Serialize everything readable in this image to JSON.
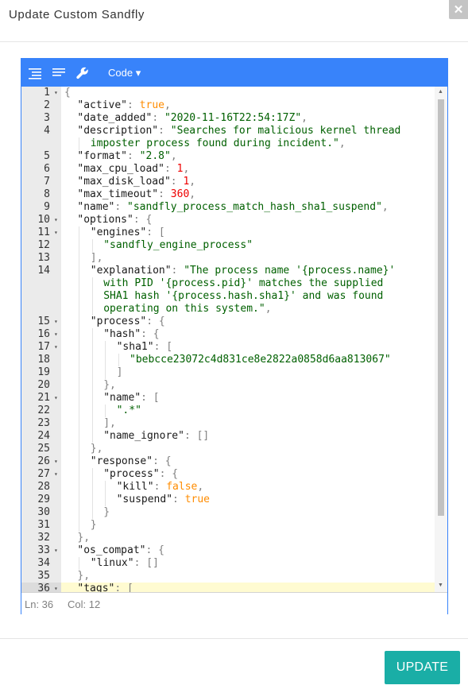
{
  "modal": {
    "title": "Update Custom Sandfly",
    "close_glyph": "✕"
  },
  "menubar": {
    "mode_label": "Code ▾",
    "icons": [
      "format-icon",
      "compact-icon",
      "repair-icon"
    ]
  },
  "status": {
    "line": "Ln: 36",
    "col": "Col: 12"
  },
  "footer": {
    "update_label": "UPDATE"
  },
  "colors": {
    "accent": "#3883fa",
    "button": "#1aaea6",
    "string": "#006000",
    "number": "#ee0000",
    "boolean": "#ff8c00"
  },
  "code_lines": [
    {
      "num": "1",
      "fold": true,
      "indent": 0,
      "tokens": [
        [
          "p",
          "{"
        ]
      ]
    },
    {
      "num": "2",
      "fold": false,
      "indent": 1,
      "tokens": [
        [
          "k",
          "\"active\""
        ],
        [
          "p",
          ": "
        ],
        [
          "b",
          "true"
        ],
        [
          "p",
          ","
        ]
      ]
    },
    {
      "num": "3",
      "fold": false,
      "indent": 1,
      "tokens": [
        [
          "k",
          "\"date_added\""
        ],
        [
          "p",
          ": "
        ],
        [
          "s",
          "\"2020-11-16T22:54:17Z\""
        ],
        [
          "p",
          ","
        ]
      ]
    },
    {
      "num": "4",
      "fold": false,
      "indent": 1,
      "tokens": [
        [
          "k",
          "\"description\""
        ],
        [
          "p",
          ": "
        ],
        [
          "s",
          "\"Searches for malicious kernel thread"
        ]
      ]
    },
    {
      "num": "",
      "fold": false,
      "indent": 2,
      "cont": true,
      "tokens": [
        [
          "s",
          "imposter process found during incident.\""
        ],
        [
          "p",
          ","
        ]
      ]
    },
    {
      "num": "5",
      "fold": false,
      "indent": 1,
      "tokens": [
        [
          "k",
          "\"format\""
        ],
        [
          "p",
          ": "
        ],
        [
          "s",
          "\"2.8\""
        ],
        [
          "p",
          ","
        ]
      ]
    },
    {
      "num": "6",
      "fold": false,
      "indent": 1,
      "tokens": [
        [
          "k",
          "\"max_cpu_load\""
        ],
        [
          "p",
          ": "
        ],
        [
          "n",
          "1"
        ],
        [
          "p",
          ","
        ]
      ]
    },
    {
      "num": "7",
      "fold": false,
      "indent": 1,
      "tokens": [
        [
          "k",
          "\"max_disk_load\""
        ],
        [
          "p",
          ": "
        ],
        [
          "n",
          "1"
        ],
        [
          "p",
          ","
        ]
      ]
    },
    {
      "num": "8",
      "fold": false,
      "indent": 1,
      "tokens": [
        [
          "k",
          "\"max_timeout\""
        ],
        [
          "p",
          ": "
        ],
        [
          "n",
          "360"
        ],
        [
          "p",
          ","
        ]
      ]
    },
    {
      "num": "9",
      "fold": false,
      "indent": 1,
      "tokens": [
        [
          "k",
          "\"name\""
        ],
        [
          "p",
          ": "
        ],
        [
          "s",
          "\"sandfly_process_match_hash_sha1_suspend\""
        ],
        [
          "p",
          ","
        ]
      ]
    },
    {
      "num": "10",
      "fold": true,
      "indent": 1,
      "tokens": [
        [
          "k",
          "\"options\""
        ],
        [
          "p",
          ": {"
        ]
      ]
    },
    {
      "num": "11",
      "fold": true,
      "indent": 2,
      "tokens": [
        [
          "k",
          "\"engines\""
        ],
        [
          "p",
          ": ["
        ]
      ]
    },
    {
      "num": "12",
      "fold": false,
      "indent": 3,
      "tokens": [
        [
          "s",
          "\"sandfly_engine_process\""
        ]
      ]
    },
    {
      "num": "13",
      "fold": false,
      "indent": 2,
      "tokens": [
        [
          "p",
          "],"
        ]
      ]
    },
    {
      "num": "14",
      "fold": false,
      "indent": 2,
      "tokens": [
        [
          "k",
          "\"explanation\""
        ],
        [
          "p",
          ": "
        ],
        [
          "s",
          "\"The process name '{process.name}'"
        ]
      ]
    },
    {
      "num": "",
      "fold": false,
      "indent": 3,
      "cont": true,
      "tokens": [
        [
          "s",
          "with PID '{process.pid}' matches the supplied"
        ]
      ]
    },
    {
      "num": "",
      "fold": false,
      "indent": 3,
      "cont": true,
      "tokens": [
        [
          "s",
          "SHA1 hash '{process.hash.sha1}' and was found"
        ]
      ]
    },
    {
      "num": "",
      "fold": false,
      "indent": 3,
      "cont": true,
      "tokens": [
        [
          "s",
          "operating on this system.\""
        ],
        [
          "p",
          ","
        ]
      ]
    },
    {
      "num": "15",
      "fold": true,
      "indent": 2,
      "tokens": [
        [
          "k",
          "\"process\""
        ],
        [
          "p",
          ": {"
        ]
      ]
    },
    {
      "num": "16",
      "fold": true,
      "indent": 3,
      "tokens": [
        [
          "k",
          "\"hash\""
        ],
        [
          "p",
          ": {"
        ]
      ]
    },
    {
      "num": "17",
      "fold": true,
      "indent": 4,
      "tokens": [
        [
          "k",
          "\"sha1\""
        ],
        [
          "p",
          ": ["
        ]
      ]
    },
    {
      "num": "18",
      "fold": false,
      "indent": 5,
      "tokens": [
        [
          "s",
          "\"bebcce23072c4d831ce8e2822a0858d6aa813067\""
        ]
      ]
    },
    {
      "num": "19",
      "fold": false,
      "indent": 4,
      "tokens": [
        [
          "p",
          "]"
        ]
      ]
    },
    {
      "num": "20",
      "fold": false,
      "indent": 3,
      "tokens": [
        [
          "p",
          "},"
        ]
      ]
    },
    {
      "num": "21",
      "fold": true,
      "indent": 3,
      "tokens": [
        [
          "k",
          "\"name\""
        ],
        [
          "p",
          ": ["
        ]
      ]
    },
    {
      "num": "22",
      "fold": false,
      "indent": 4,
      "tokens": [
        [
          "s",
          "\".*\""
        ]
      ]
    },
    {
      "num": "23",
      "fold": false,
      "indent": 3,
      "tokens": [
        [
          "p",
          "],"
        ]
      ]
    },
    {
      "num": "24",
      "fold": false,
      "indent": 3,
      "tokens": [
        [
          "k",
          "\"name_ignore\""
        ],
        [
          "p",
          ": []"
        ]
      ]
    },
    {
      "num": "25",
      "fold": false,
      "indent": 2,
      "tokens": [
        [
          "p",
          "},"
        ]
      ]
    },
    {
      "num": "26",
      "fold": true,
      "indent": 2,
      "tokens": [
        [
          "k",
          "\"response\""
        ],
        [
          "p",
          ": {"
        ]
      ]
    },
    {
      "num": "27",
      "fold": true,
      "indent": 3,
      "tokens": [
        [
          "k",
          "\"process\""
        ],
        [
          "p",
          ": {"
        ]
      ]
    },
    {
      "num": "28",
      "fold": false,
      "indent": 4,
      "tokens": [
        [
          "k",
          "\"kill\""
        ],
        [
          "p",
          ": "
        ],
        [
          "b",
          "false"
        ],
        [
          "p",
          ","
        ]
      ]
    },
    {
      "num": "29",
      "fold": false,
      "indent": 4,
      "tokens": [
        [
          "k",
          "\"suspend\""
        ],
        [
          "p",
          ": "
        ],
        [
          "b",
          "true"
        ]
      ]
    },
    {
      "num": "30",
      "fold": false,
      "indent": 3,
      "tokens": [
        [
          "p",
          "}"
        ]
      ]
    },
    {
      "num": "31",
      "fold": false,
      "indent": 2,
      "tokens": [
        [
          "p",
          "}"
        ]
      ]
    },
    {
      "num": "32",
      "fold": false,
      "indent": 1,
      "tokens": [
        [
          "p",
          "},"
        ]
      ]
    },
    {
      "num": "33",
      "fold": true,
      "indent": 1,
      "tokens": [
        [
          "k",
          "\"os_compat\""
        ],
        [
          "p",
          ": {"
        ]
      ]
    },
    {
      "num": "34",
      "fold": false,
      "indent": 2,
      "tokens": [
        [
          "k",
          "\"linux\""
        ],
        [
          "p",
          ": []"
        ]
      ]
    },
    {
      "num": "35",
      "fold": false,
      "indent": 1,
      "tokens": [
        [
          "p",
          "},"
        ]
      ]
    },
    {
      "num": "36",
      "fold": true,
      "indent": 1,
      "active": true,
      "tokens": [
        [
          "k",
          "\"tags\""
        ],
        [
          "p",
          ": ["
        ]
      ]
    }
  ]
}
